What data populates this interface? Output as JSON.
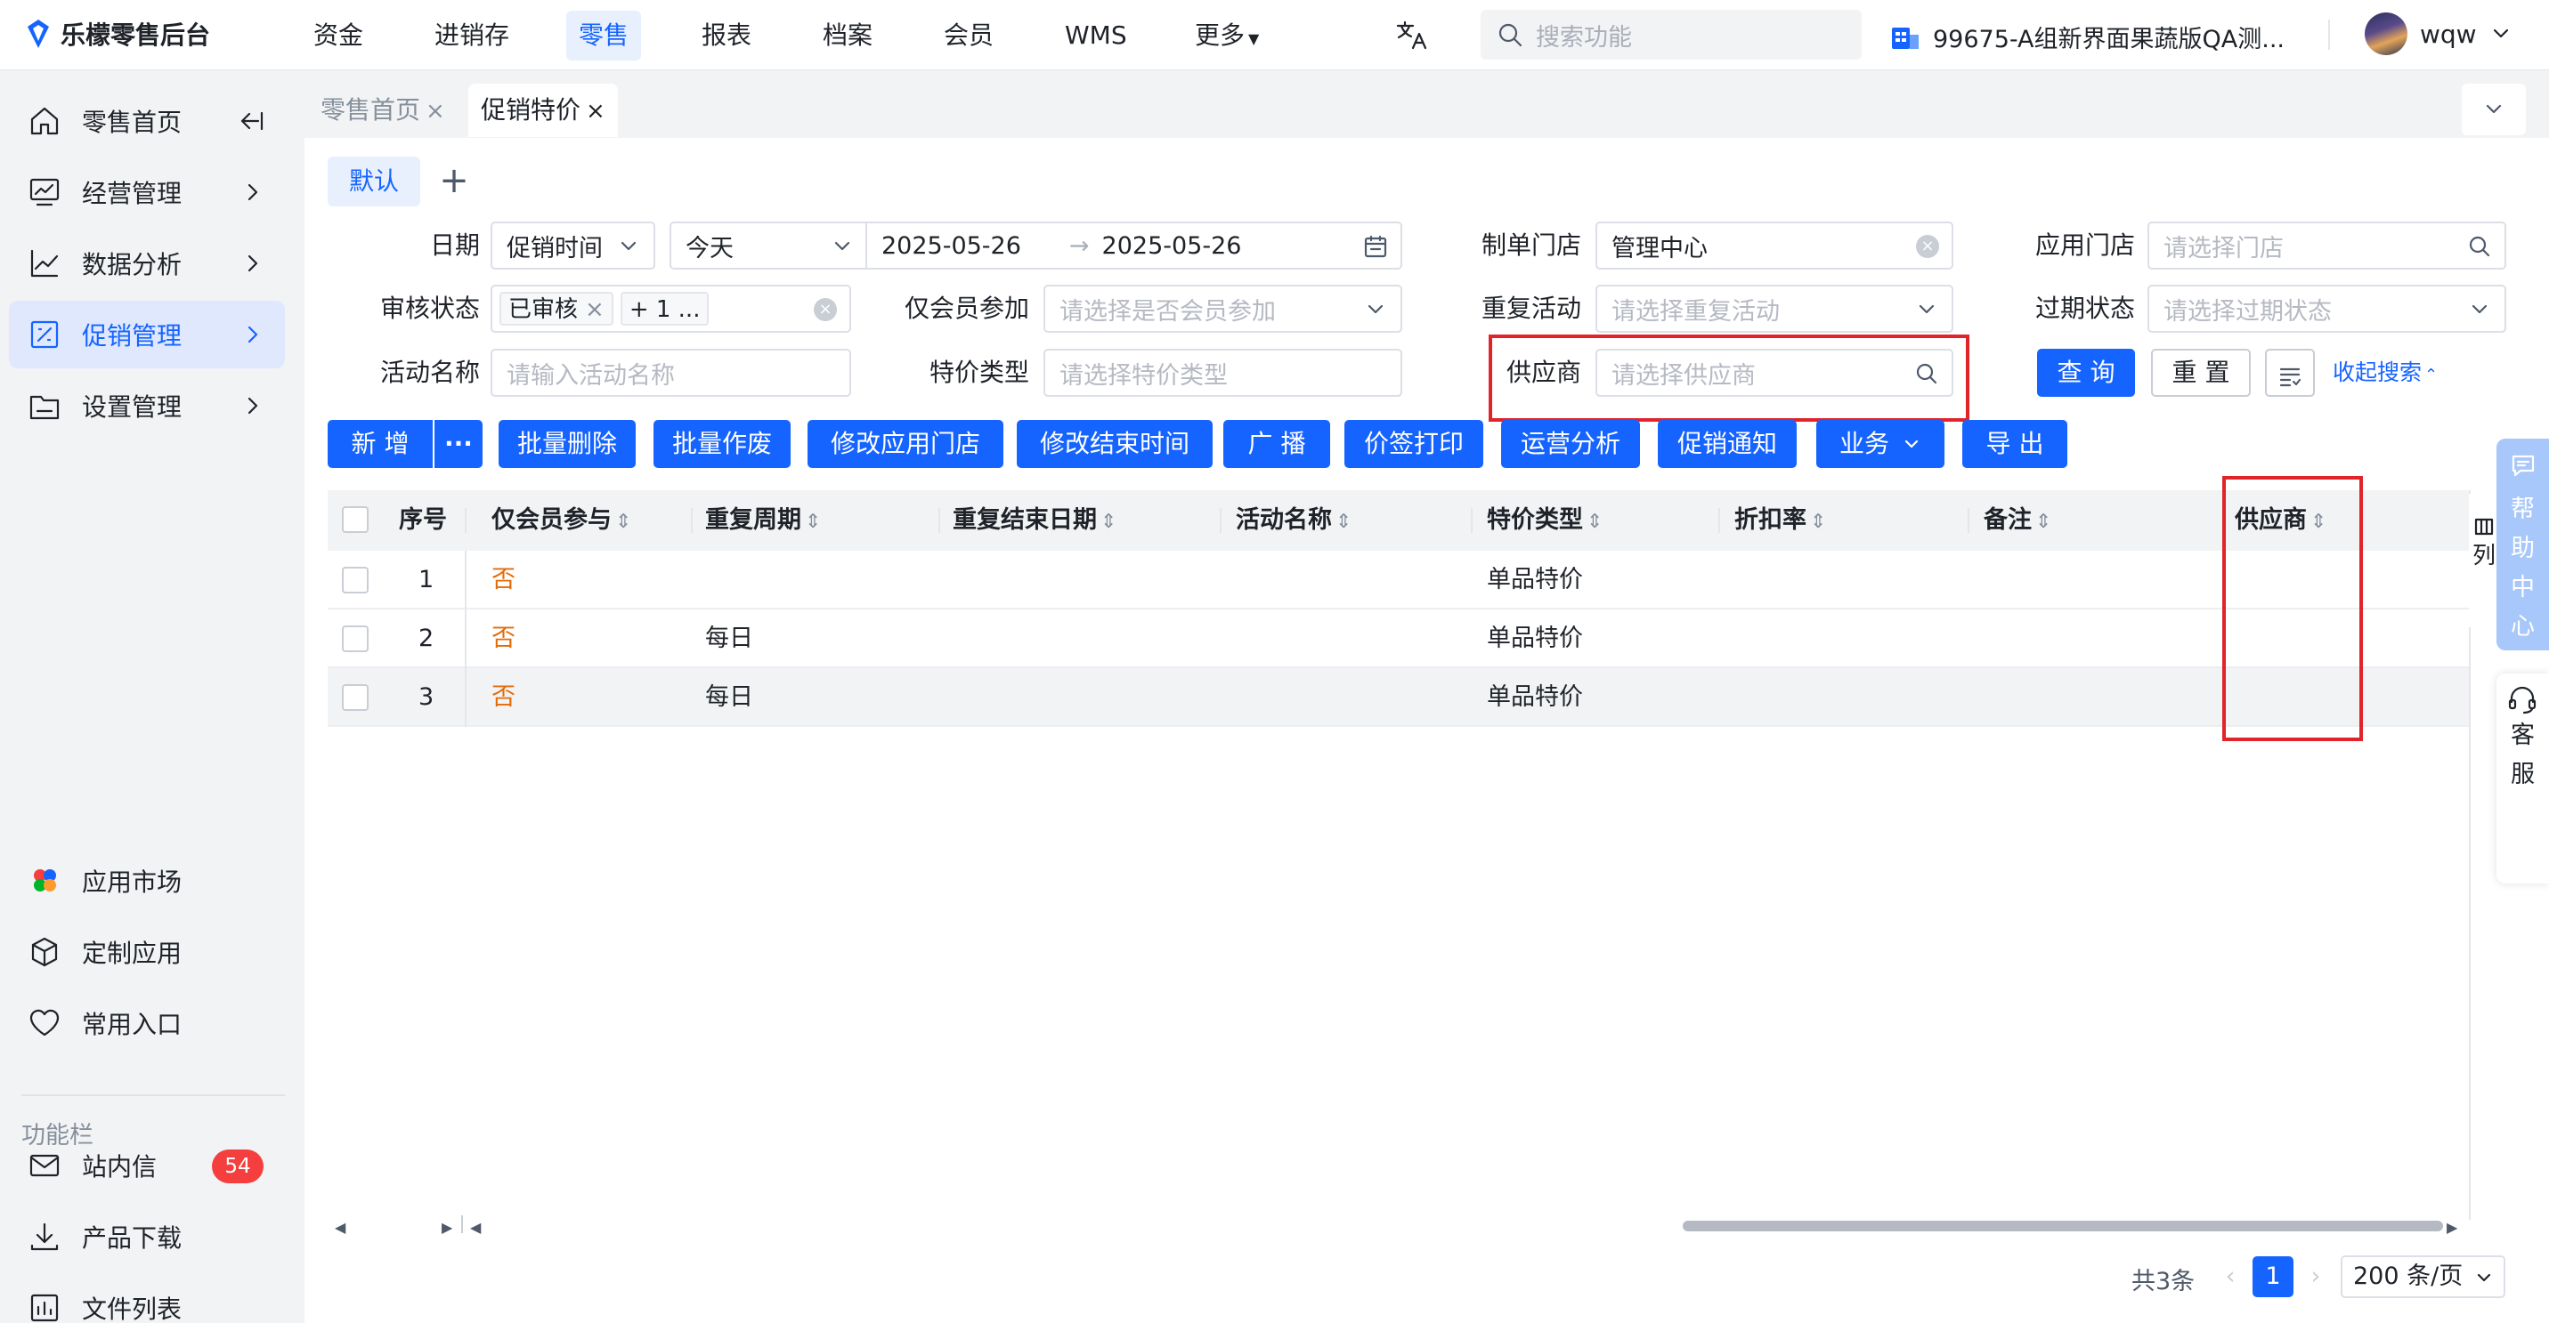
{
  "app": {
    "name": "乐檬零售后台"
  },
  "topnav": [
    "资金",
    "进销存",
    "零售",
    "报表",
    "档案",
    "会员",
    "WMS",
    "更多"
  ],
  "search": {
    "placeholder": "搜索功能"
  },
  "org": {
    "name": "99675-A组新界面果蔬版QA测..."
  },
  "user": {
    "name": "wqw"
  },
  "sidebar": {
    "items": [
      {
        "label": "零售首页",
        "icon": "home-icon"
      },
      {
        "label": "经营管理",
        "icon": "chart-board-icon"
      },
      {
        "label": "数据分析",
        "icon": "trend-icon"
      },
      {
        "label": "促销管理",
        "icon": "promotion-icon",
        "active": true
      },
      {
        "label": "设置管理",
        "icon": "folder-icon"
      }
    ],
    "bottom": [
      {
        "label": "应用市场",
        "icon": "app-market-icon"
      },
      {
        "label": "定制应用",
        "icon": "cube-icon"
      },
      {
        "label": "常用入口",
        "icon": "heart-icon"
      }
    ],
    "section_label": "功能栏",
    "tools": [
      {
        "label": "站内信",
        "icon": "mail-icon",
        "badge": "54"
      },
      {
        "label": "产品下载",
        "icon": "download-icon"
      },
      {
        "label": "文件列表",
        "icon": "file-list-icon"
      }
    ]
  },
  "pagetabs": [
    {
      "label": "零售首页",
      "close": "×"
    },
    {
      "label": "促销特价",
      "close": "×",
      "active": true
    }
  ],
  "view_tab": "默认",
  "filters": {
    "date": {
      "label": "日期",
      "type": "促销时间",
      "preset": "今天",
      "start": "2025-05-26",
      "end": "2025-05-26"
    },
    "store": {
      "label": "制单门店",
      "value": "管理中心"
    },
    "apply_store": {
      "label": "应用门店",
      "placeholder": "请选择门店"
    },
    "audit": {
      "label": "审核状态",
      "chip": "已审核",
      "more": "+ 1 ..."
    },
    "member_only": {
      "label": "仅会员参加",
      "placeholder": "请选择是否会员参加"
    },
    "repeat": {
      "label": "重复活动",
      "placeholder": "请选择重复活动"
    },
    "expired": {
      "label": "过期状态",
      "placeholder": "请选择过期状态"
    },
    "activity_name": {
      "label": "活动名称",
      "placeholder": "请输入活动名称"
    },
    "special_type": {
      "label": "特价类型",
      "placeholder": "请选择特价类型"
    },
    "supplier": {
      "label": "供应商",
      "placeholder": "请选择供应商"
    },
    "query": "查 询",
    "reset": "重 置",
    "collapse": "收起搜索"
  },
  "toolbar": [
    "新 增",
    "批量删除",
    "批量作废",
    "修改应用门店",
    "修改结束时间",
    "广 播",
    "价签打印",
    "运营分析",
    "促销通知",
    "业务",
    "导 出"
  ],
  "table": {
    "columns": [
      "序号",
      "仅会员参与",
      "重复周期",
      "重复结束日期",
      "活动名称",
      "特价类型",
      "折扣率",
      "备注",
      "供应商"
    ],
    "rows": [
      {
        "no": "1",
        "member": "否",
        "cycle": "",
        "end": "",
        "name": "",
        "type": "单品特价",
        "rate": "",
        "note": "",
        "supplier": ""
      },
      {
        "no": "2",
        "member": "否",
        "cycle": "每日",
        "end": "",
        "name": "",
        "type": "单品特价",
        "rate": "",
        "note": "",
        "supplier": ""
      },
      {
        "no": "3",
        "member": "否",
        "cycle": "每日",
        "end": "",
        "name": "",
        "type": "单品特价",
        "rate": "",
        "note": "",
        "supplier": ""
      }
    ]
  },
  "right_cut_text": "列",
  "help": {
    "chars": [
      "帮",
      "助",
      "中",
      "心"
    ]
  },
  "kefu": {
    "chars": [
      "客",
      "服"
    ]
  },
  "pagination": {
    "total": "共3条",
    "current": "1",
    "page_size": "200 条/页"
  },
  "colors": {
    "primary": "#1664ff",
    "highlight": "#e0242a",
    "danger_badge": "#f53f3f",
    "member_no": "#e36c09"
  }
}
